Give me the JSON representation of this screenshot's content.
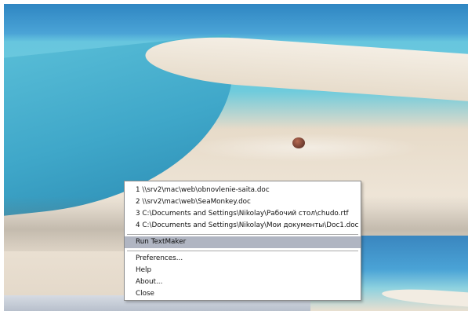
{
  "recent_files": [
    {
      "label": "1 \\\\srv2\\mac\\web\\obnovlenie-saita.doc"
    },
    {
      "label": "2 \\\\srv2\\mac\\web\\SeaMonkey.doc"
    },
    {
      "label": "3 C:\\Documents and Settings\\Nikolay\\Рабочий стол\\chudo.rtf"
    },
    {
      "label": "4 C:\\Documents and Settings\\Nikolay\\Мои документы\\Doc1.doc"
    }
  ],
  "primary_action": {
    "label": "Run TextMaker"
  },
  "options": [
    {
      "label": "Preferences..."
    },
    {
      "label": "Help"
    },
    {
      "label": "About..."
    },
    {
      "label": "Close"
    }
  ],
  "colors": {
    "menu_highlight": "#b0b5c2",
    "menu_border": "#8c8c8c"
  }
}
